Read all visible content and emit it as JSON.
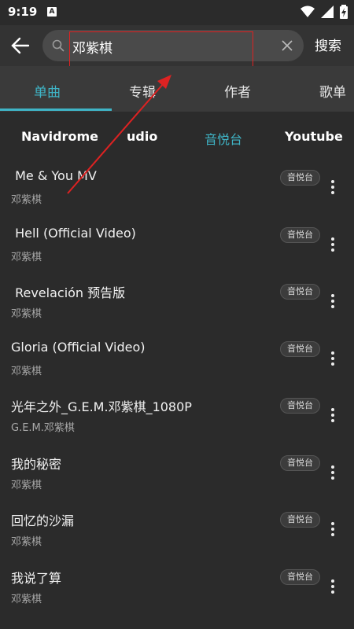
{
  "status_bar": {
    "time": "9:19",
    "notification_badge": "A",
    "icons": [
      "wifi-icon",
      "signal-icon",
      "battery-charging-icon"
    ]
  },
  "top_bar": {
    "search_value": "邓紫棋",
    "search_button": "搜索"
  },
  "tabs": [
    {
      "label": "单曲",
      "active": true
    },
    {
      "label": "专辑",
      "active": false
    },
    {
      "label": "作者",
      "active": false
    },
    {
      "label": "歌单",
      "active": false
    }
  ],
  "sources": [
    {
      "label": "Navidrome",
      "active": false
    },
    {
      "label": "udio",
      "active": false
    },
    {
      "label": "音悦台",
      "active": true
    },
    {
      "label": "Youtube",
      "active": false
    }
  ],
  "results": [
    {
      "title": " Me & You MV",
      "artist": "邓紫棋",
      "source": "音悦台"
    },
    {
      "title": " Hell (Official Video)",
      "artist": "邓紫棋",
      "source": "音悦台"
    },
    {
      "title": " Revelación 预告版",
      "artist": "邓紫棋",
      "source": "音悦台"
    },
    {
      "title": "Gloria (Official Video)",
      "artist": "邓紫棋",
      "source": "音悦台"
    },
    {
      "title": "光年之外_G.E.M.邓紫棋_1080P",
      "artist": "G.E.M.邓紫棋",
      "source": "音悦台"
    },
    {
      "title": "我的秘密",
      "artist": "邓紫棋",
      "source": "音悦台"
    },
    {
      "title": "回忆的沙漏",
      "artist": "邓紫棋",
      "source": "音悦台"
    },
    {
      "title": "我说了算",
      "artist": "邓紫棋",
      "source": "音悦台"
    }
  ],
  "colors": {
    "accent": "#3fb4c6",
    "background": "#2b2b2b",
    "annotation": "#dd2222"
  }
}
